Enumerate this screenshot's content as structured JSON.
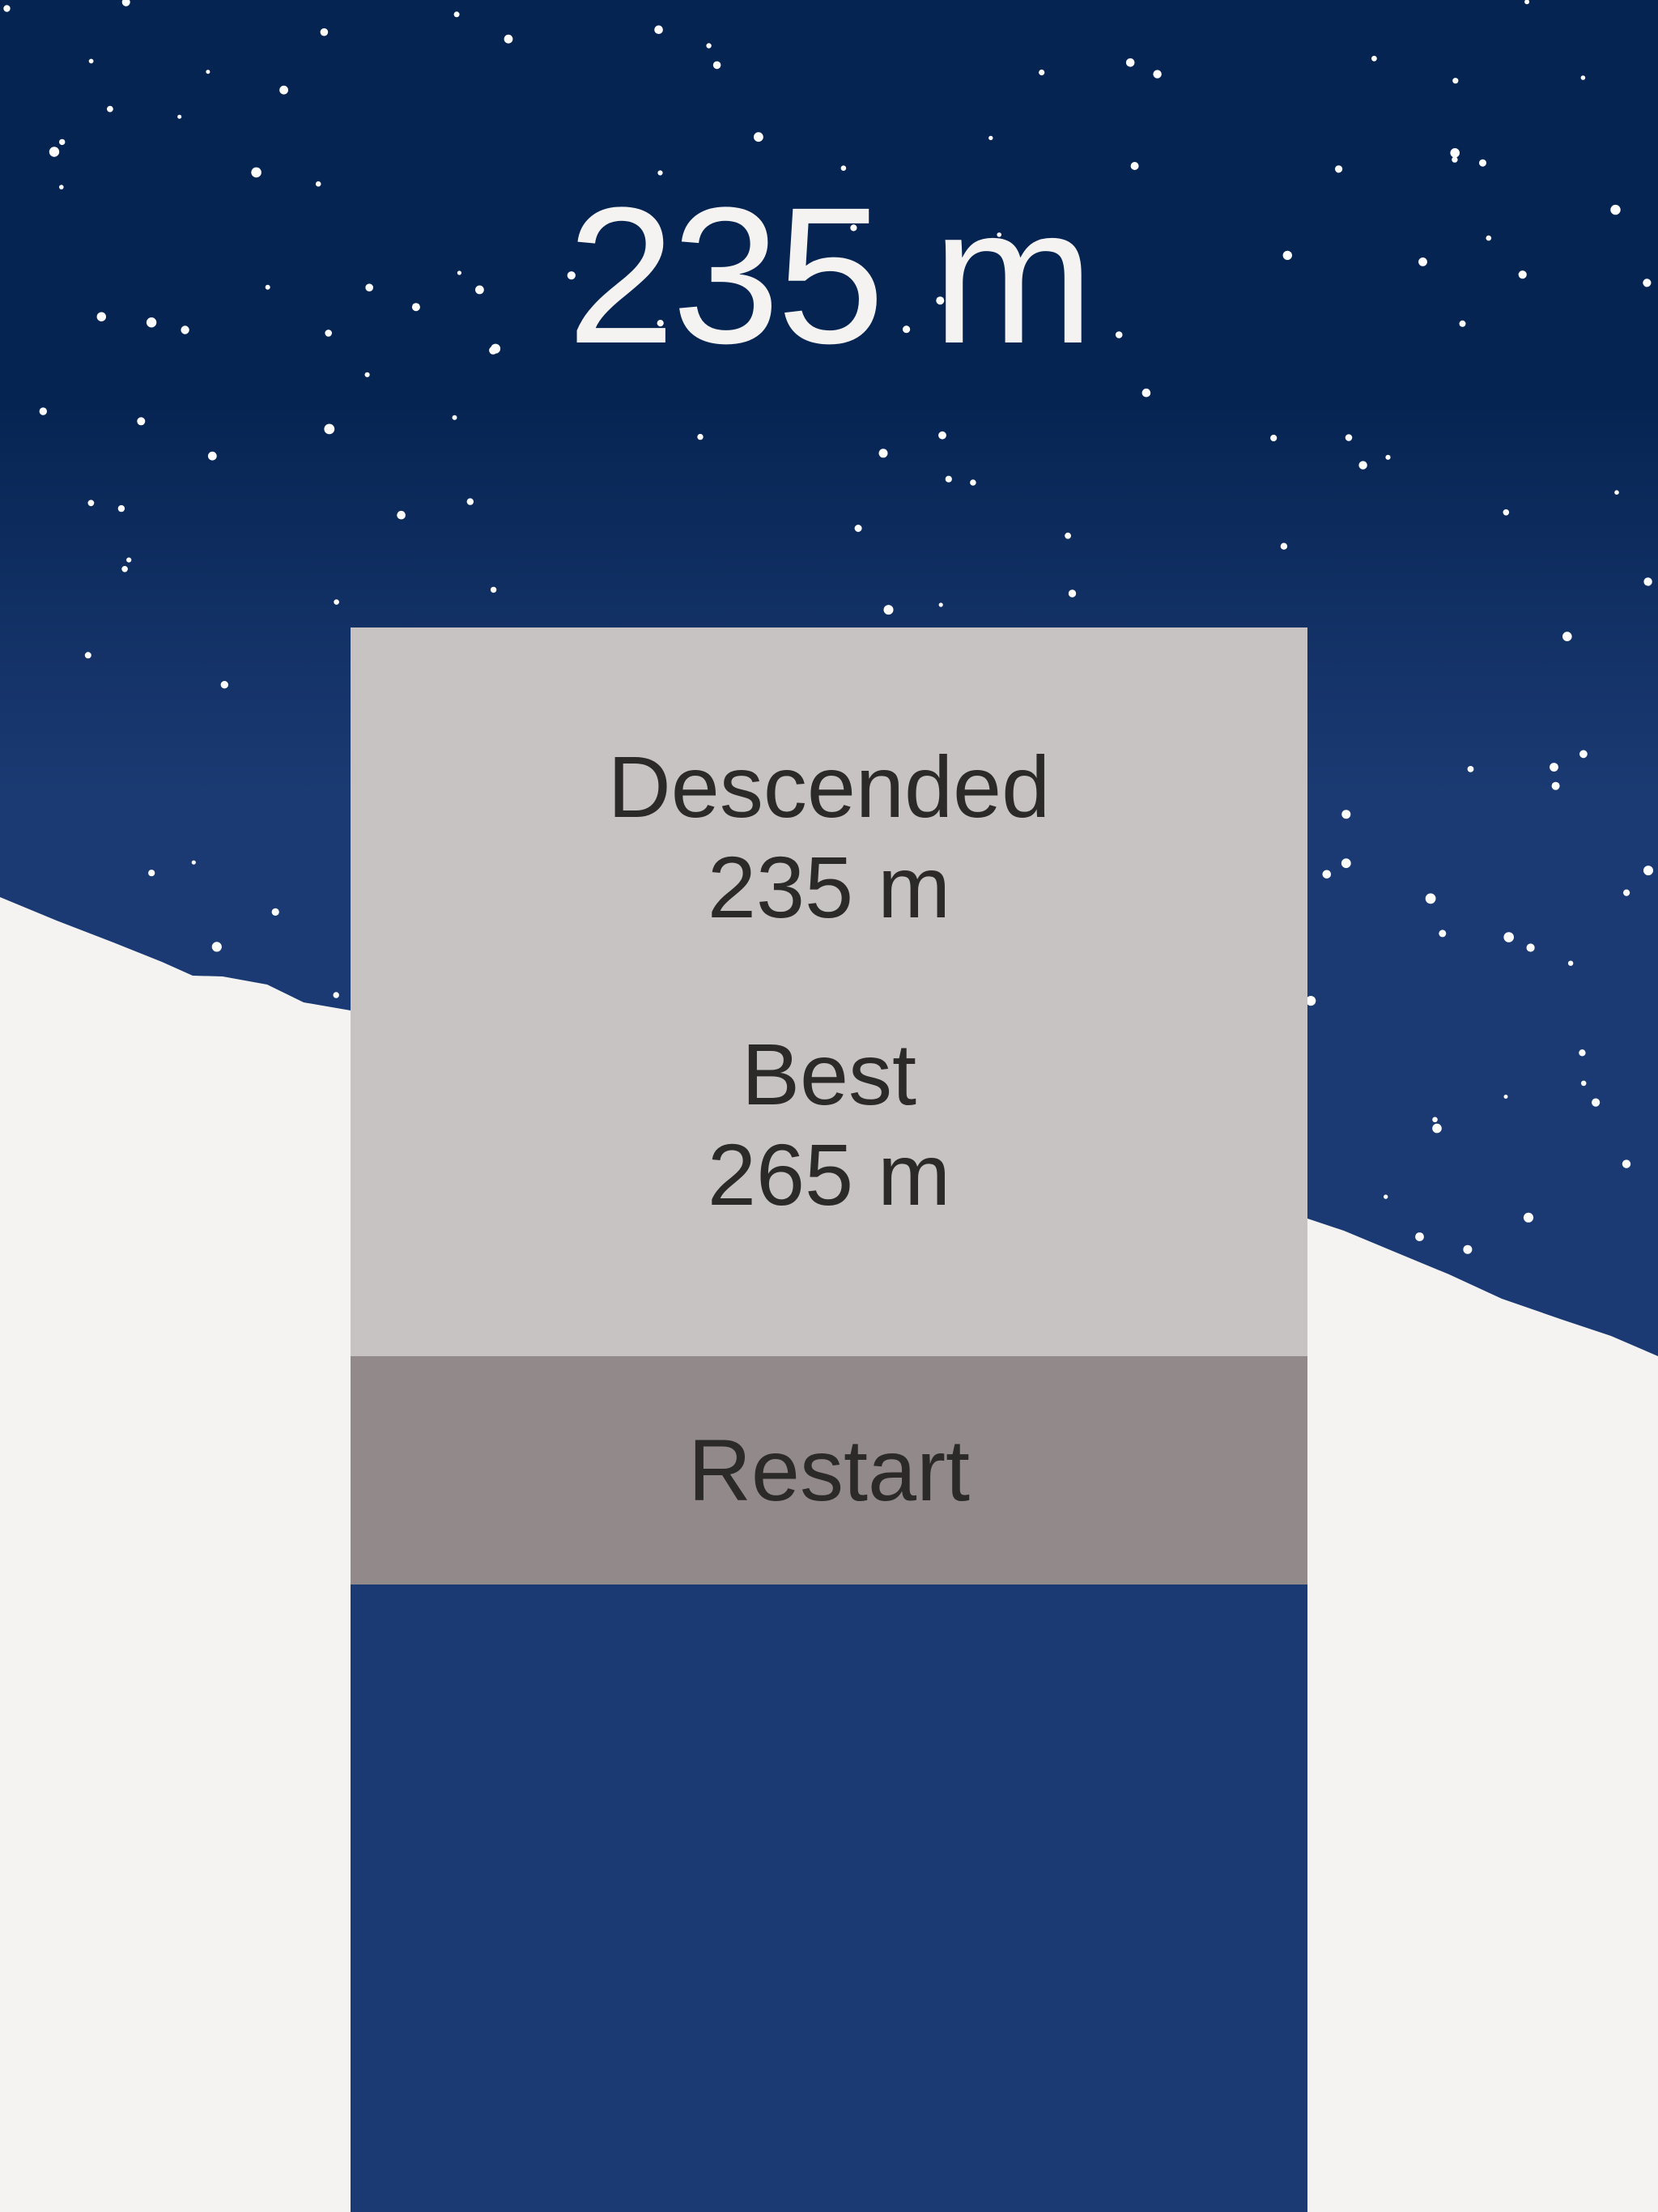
{
  "hud": {
    "distance": "235 m"
  },
  "gameover": {
    "descended_label": "Descended",
    "descended_value": "235 m",
    "best_label": "Best",
    "best_value": "265 m",
    "restart_label": "Restart"
  },
  "colors": {
    "sky_top": "#062452",
    "sky_bottom": "#1b3a73",
    "snow": "#f4f3f1",
    "panel": "#c8c3c3",
    "button": "#928a8a",
    "text_dark": "#2c2929",
    "star": "#ffffff"
  }
}
